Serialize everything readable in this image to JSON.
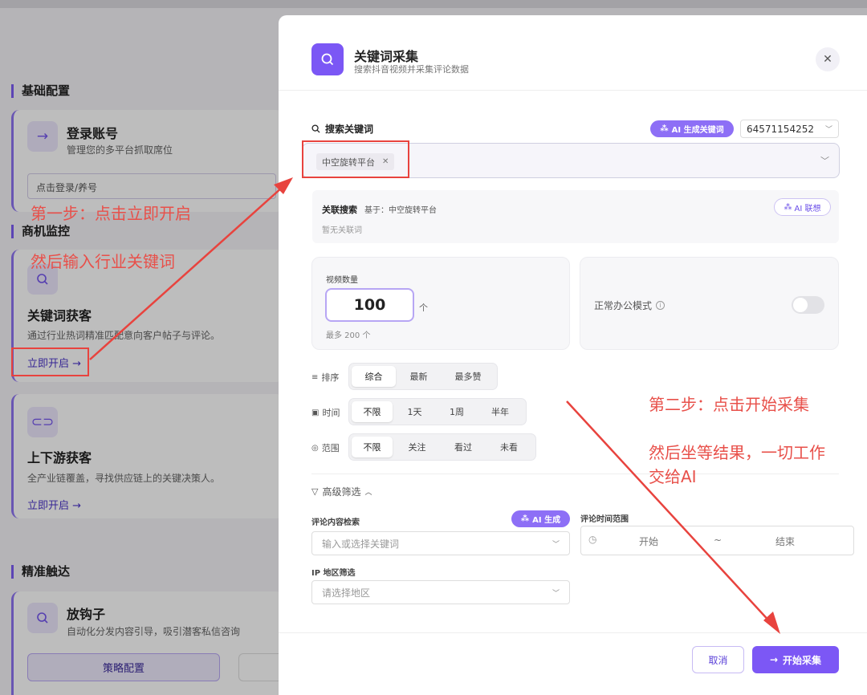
{
  "background": {
    "sections": [
      {
        "title": "基础配置"
      },
      {
        "title": "商机监控"
      },
      {
        "title": "精准触达"
      }
    ],
    "login_card": {
      "title": "登录账号",
      "desc": "管理您的多平台抓取席位",
      "field": "点击登录/养号",
      "icon": "arrow-right-icon"
    },
    "keyword_card": {
      "title": "关键词获客",
      "desc": "通过行业热词精准匹配意向客户帖子与评论。",
      "link": "立即开启 →",
      "icon": "search-icon"
    },
    "updown_card": {
      "title": "上下游获客",
      "desc": "全产业链覆盖，寻找供应链上的关键决策人。",
      "link": "立即开启 →",
      "icon": "link-icon"
    },
    "hook_card": {
      "title": "放钩子",
      "desc": "自动化分发内容引导，吸引潜客私信咨询",
      "button": "策略配置",
      "icon": "search-icon"
    }
  },
  "modal": {
    "title": "关键词采集",
    "subtitle": "搜索抖音视频并采集评论数据",
    "close_icon": "close-icon",
    "search_label": "搜索关键词",
    "ai_generate_kw": "AI 生成关键词",
    "account": "64571154252",
    "keyword_tags": [
      "中空旋转平台"
    ],
    "related": {
      "title": "关联搜索",
      "base": "基于：中空旋转平台",
      "empty": "暂无关联词",
      "ai_button": "AI 联想"
    },
    "video_count": {
      "label": "视频数量",
      "value": "100",
      "unit": "个",
      "max": "最多 200 个"
    },
    "office_mode": {
      "label": "正常办公模式",
      "on": false
    },
    "filters": [
      {
        "label": "排序",
        "icon": "filter-icon",
        "options": [
          "综合",
          "最新",
          "最多赞"
        ],
        "selected": 0
      },
      {
        "label": "时间",
        "icon": "calendar-icon",
        "options": [
          "不限",
          "1天",
          "1周",
          "半年"
        ],
        "selected": 0
      },
      {
        "label": "范围",
        "icon": "target-icon",
        "options": [
          "不限",
          "关注",
          "看过",
          "未看"
        ],
        "selected": 0
      }
    ],
    "advanced": {
      "label": "高级筛选",
      "comment_search_label": "评论内容检索",
      "ai_generate": "AI 生成",
      "comment_placeholder": "输入或选择关键词",
      "time_range_label": "评论时间范围",
      "start": "开始",
      "sep": "~",
      "end": "结束",
      "ip_label": "IP 地区筛选",
      "ip_placeholder": "请选择地区"
    },
    "cancel": "取消",
    "start": "开始采集"
  },
  "annotations": {
    "step1_line1": "第一步：点击立即开启",
    "step1_line2": "然后输入行业关键词",
    "step2_line1": "第二步：点击开始采集",
    "step2_line2": "然后坐等结果，一切工作",
    "step2_line3": "交给AI",
    "color": "#e8504a"
  },
  "colors": {
    "accent": "#7c57f5",
    "annotation": "#e8433e"
  }
}
